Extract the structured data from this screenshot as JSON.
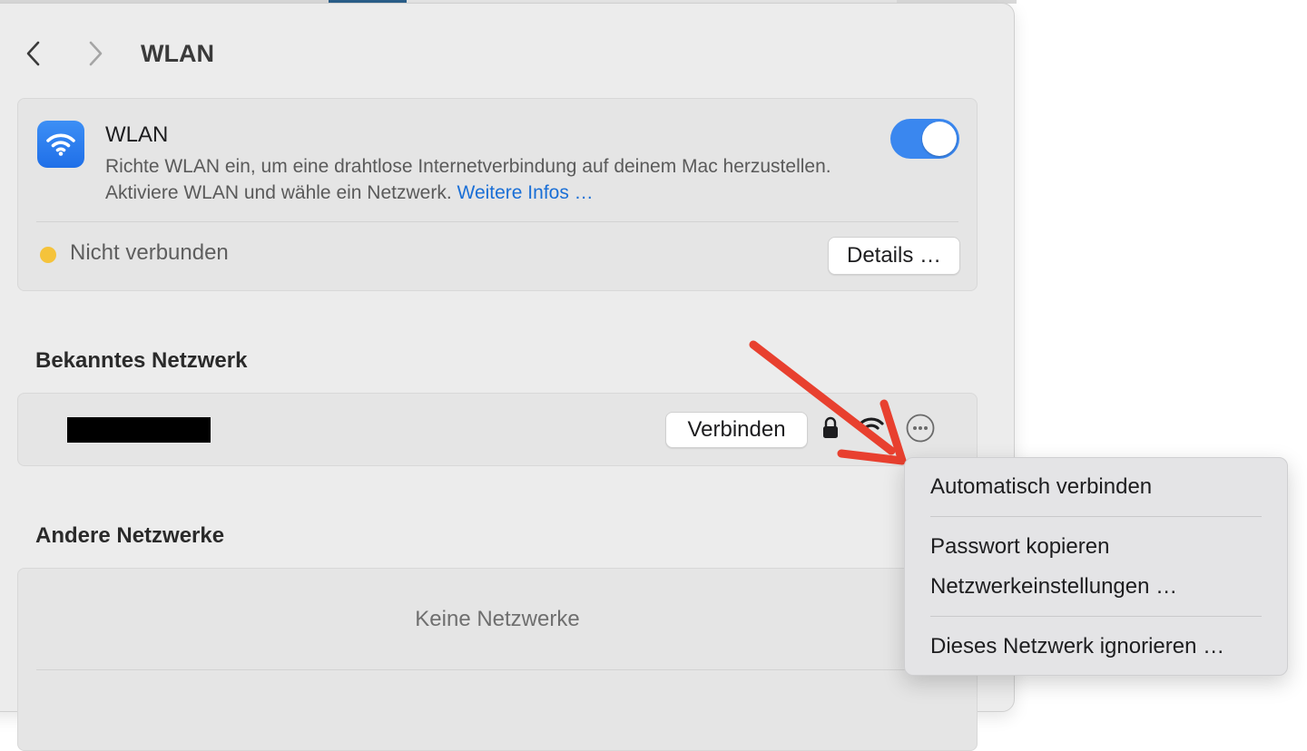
{
  "nav": {
    "back_icon": "chevron-left-icon",
    "forward_icon": "chevron-right-icon",
    "title": "WLAN"
  },
  "wifi_panel": {
    "icon": "wifi-icon",
    "title": "WLAN",
    "description": "Richte WLAN ein, um eine drahtlose Internetverbindung auf deinem Mac herzustellen. Aktiviere WLAN und wähle ein Netzwerk.",
    "learn_more_link": "Weitere Infos …",
    "toggle_on": true,
    "status": "Nicht verbunden",
    "status_color": "#f5c33b",
    "details_button": "Details …"
  },
  "known_network": {
    "heading": "Bekanntes Netzwerk",
    "connect_button": "Verbinden",
    "lock_icon": "lock-icon",
    "signal_icon": "wifi-signal-icon",
    "more_icon": "ellipsis-circle-icon"
  },
  "other_networks": {
    "heading": "Andere Netzwerke",
    "empty_text": "Keine Netzwerke"
  },
  "context_menu": {
    "items": [
      "Automatisch verbinden",
      "Passwort kopieren",
      "Netzwerkeinstellungen …",
      "Dieses Netzwerk ignorieren …"
    ]
  },
  "colors": {
    "accent": "#3a87ef",
    "link": "#1a6fd6",
    "annotation_arrow": "#e8402f"
  }
}
